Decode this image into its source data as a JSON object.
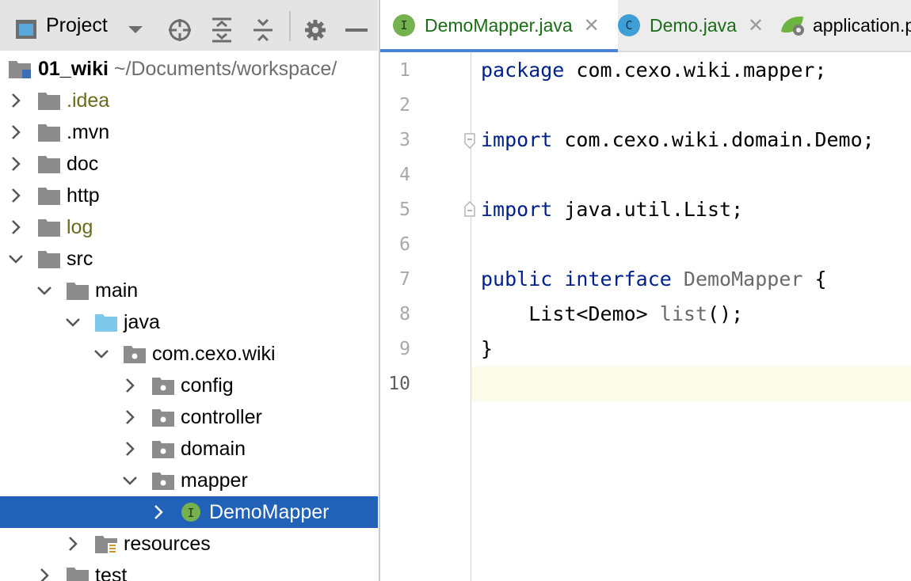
{
  "project_panel": {
    "title": "Project",
    "toolbar_icons": [
      "project-view-icon",
      "dropdown-icon",
      "locate-icon",
      "expand-all-icon",
      "collapse-all-icon",
      "gear-icon",
      "minimize-icon"
    ],
    "root": {
      "name": "01_wiki",
      "path": "~/Documents/workspace/"
    },
    "tree": [
      {
        "label": ".idea",
        "state": "collapsed",
        "icon": "folder-icon"
      },
      {
        "label": ".mvn",
        "state": "collapsed",
        "icon": "folder-icon"
      },
      {
        "label": "doc",
        "state": "collapsed",
        "icon": "folder-icon"
      },
      {
        "label": "http",
        "state": "collapsed",
        "icon": "folder-icon"
      },
      {
        "label": "log",
        "state": "collapsed",
        "icon": "folder-icon"
      },
      {
        "label": "src",
        "state": "expanded",
        "icon": "folder-icon"
      },
      {
        "label": "main",
        "state": "expanded",
        "icon": "folder-icon"
      },
      {
        "label": "java",
        "state": "expanded",
        "icon": "source-folder-icon"
      },
      {
        "label": "com.cexo.wiki",
        "state": "expanded",
        "icon": "package-icon"
      },
      {
        "label": "config",
        "state": "collapsed",
        "icon": "package-icon"
      },
      {
        "label": "controller",
        "state": "collapsed",
        "icon": "package-icon"
      },
      {
        "label": "domain",
        "state": "collapsed",
        "icon": "package-icon"
      },
      {
        "label": "mapper",
        "state": "expanded",
        "icon": "package-icon"
      },
      {
        "label": "DemoMapper",
        "state": "collapsed",
        "icon": "interface-icon",
        "selected": true
      },
      {
        "label": "resources",
        "state": "collapsed",
        "icon": "resources-folder-icon"
      },
      {
        "label": "test",
        "state": "collapsed",
        "icon": "folder-icon"
      }
    ]
  },
  "editor": {
    "tabs": [
      {
        "label": "DemoMapper.java",
        "badge": "I",
        "active": true
      },
      {
        "label": "Demo.java",
        "badge": "C",
        "active": false
      },
      {
        "label": "application.p",
        "badge": "",
        "active": false
      }
    ],
    "line_numbers": [
      "1",
      "2",
      "3",
      "4",
      "5",
      "6",
      "7",
      "8",
      "9",
      "10"
    ],
    "code": {
      "l1_kw": "package",
      "l1_rest": " com.cexo.wiki.mapper;",
      "l3_kw": "import",
      "l3_rest": " com.cexo.wiki.domain.Demo;",
      "l5_kw": "import",
      "l5_rest": " java.util.List;",
      "l7_kw1": "public",
      "l7_kw2": "interface",
      "l7_name": "DemoMapper",
      "l7_rest": " {",
      "l8_type": "List<Demo> ",
      "l8_method": "list",
      "l8_rest": "();",
      "l9": "}"
    }
  },
  "colors": {
    "selection": "#2161b8",
    "keyword": "#00208c",
    "tab_underline": "#4d84d7",
    "olive_text": "#6a6b1e",
    "current_line": "#fcfbea"
  }
}
